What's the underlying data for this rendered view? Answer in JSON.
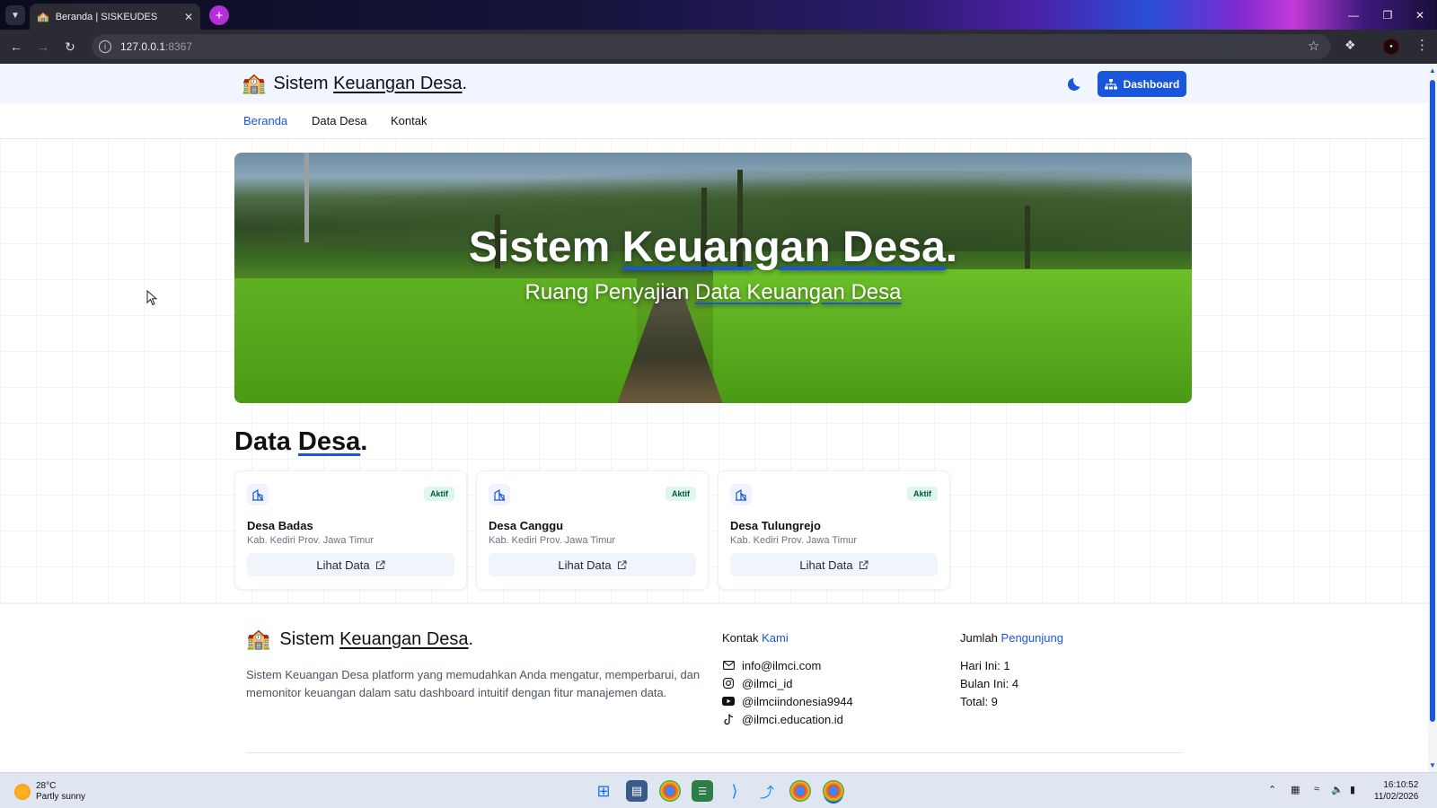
{
  "browser": {
    "tab_title": "Beranda | SISKEUDES",
    "url_host": "127.0.0.1",
    "url_port": ":8367"
  },
  "header": {
    "brand_prefix": "Sistem ",
    "brand_highlight": "Keuangan Desa",
    "brand_suffix": ".",
    "dashboard_label": "Dashboard"
  },
  "nav": {
    "items": [
      {
        "label": "Beranda",
        "active": true
      },
      {
        "label": "Data Desa",
        "active": false
      },
      {
        "label": "Kontak",
        "active": false
      }
    ]
  },
  "hero": {
    "title_prefix": "Sistem ",
    "title_highlight": "Keuangan Desa",
    "title_suffix": ".",
    "subtitle_prefix": "Ruang Penyajian ",
    "subtitle_highlight": "Data Keuangan Desa"
  },
  "section": {
    "title_prefix": "Data ",
    "title_highlight": "Desa",
    "title_suffix": "."
  },
  "villages": [
    {
      "name": "Desa Badas",
      "region": "Kab. Kediri Prov. Jawa Timur",
      "status": "Aktif",
      "action": "Lihat Data"
    },
    {
      "name": "Desa Canggu",
      "region": "Kab. Kediri Prov. Jawa Timur",
      "status": "Aktif",
      "action": "Lihat Data"
    },
    {
      "name": "Desa Tulungrejo",
      "region": "Kab. Kediri Prov. Jawa Timur",
      "status": "Aktif",
      "action": "Lihat Data"
    }
  ],
  "footer": {
    "brand_prefix": "Sistem ",
    "brand_highlight": "Keuangan Desa",
    "brand_suffix": ".",
    "description": "Sistem Keuangan Desa platform yang memudahkan Anda mengatur, memperbarui, dan memonitor keuangan dalam satu dashboard intuitif dengan fitur manajemen data.",
    "contact_title": "Kontak",
    "contact_title_hl": "Kami",
    "contacts": {
      "email": "info@ilmci.com",
      "instagram": "@ilmci_id",
      "youtube": "@ilmciindonesia9944",
      "tiktok": "@ilmci.education.id"
    },
    "visitors_title": "Jumlah",
    "visitors_title_hl": "Pengunjung",
    "visitors": {
      "today": "Hari Ini: 1",
      "month": "Bulan Ini: 4",
      "total": "Total: 9"
    }
  },
  "taskbar": {
    "temp": "28°C",
    "weather": "Partly sunny",
    "time": "16:10:52",
    "date": "11/02/2026"
  },
  "colors": {
    "accent": "#1a56db",
    "badge_bg": "#def7ec",
    "badge_text": "#03543f"
  }
}
